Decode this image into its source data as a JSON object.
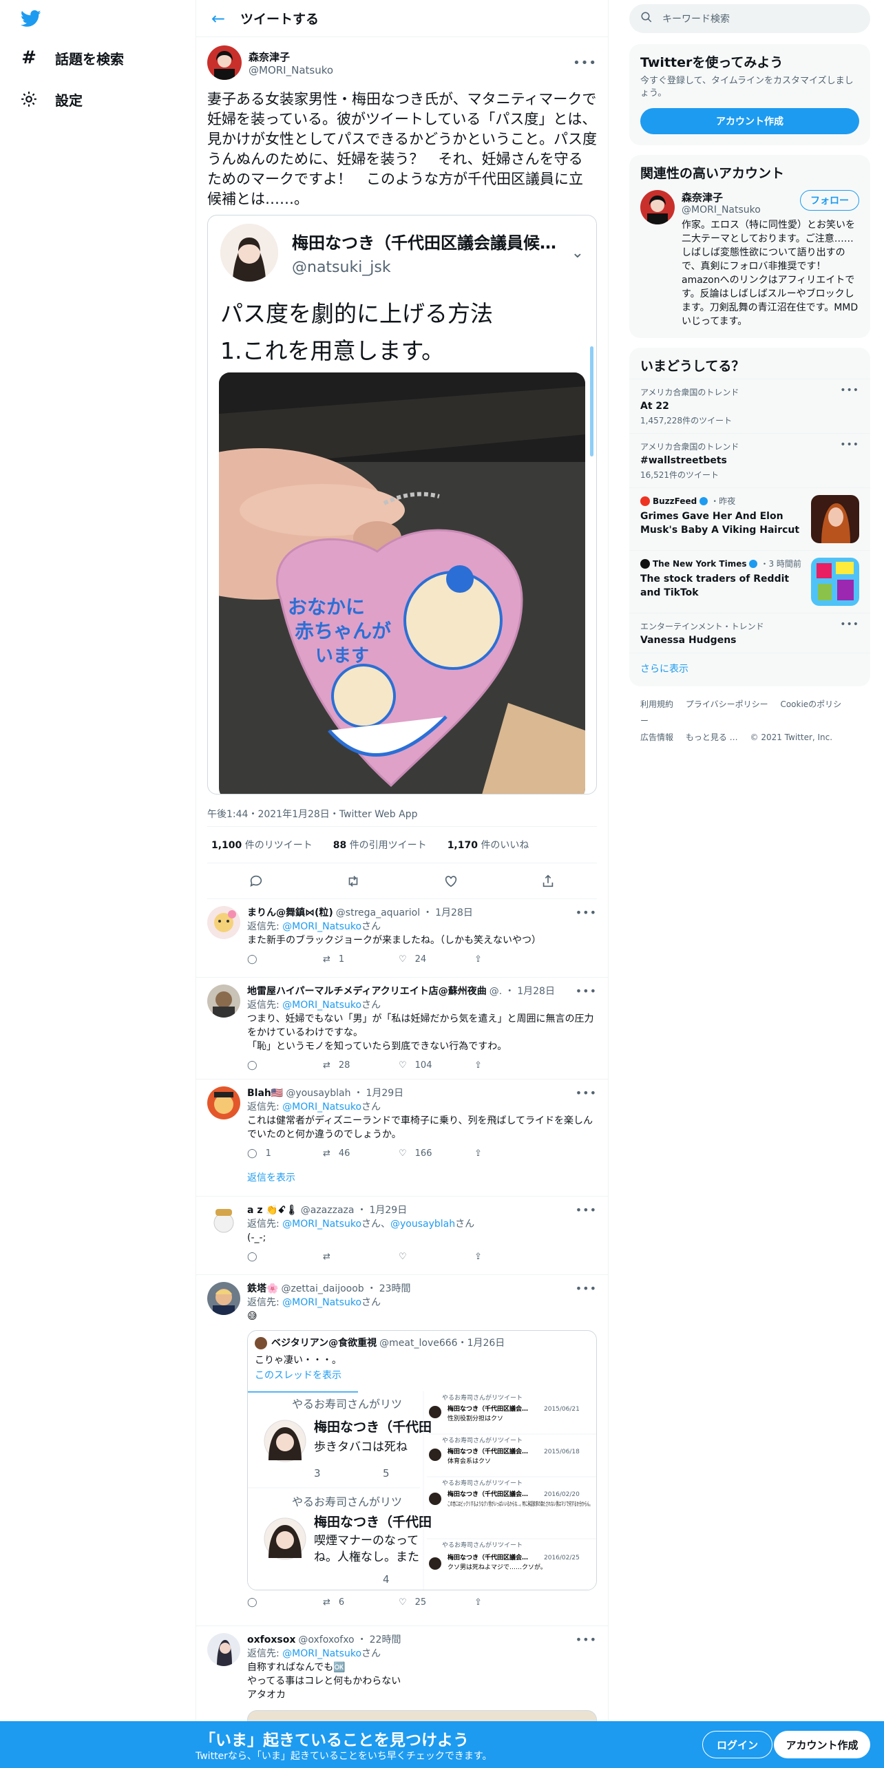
{
  "nav": {
    "explore_label": "話題を検索",
    "settings_label": "設定"
  },
  "header": {
    "title": "ツイートする"
  },
  "main_tweet": {
    "name": "森奈津子",
    "handle": "@MORI_Natsuko",
    "text": "妻子ある女装家男性・梅田なつき氏が、マタニティマークで妊婦を装っている。彼がツイートしている「パス度」とは、見かけが女性としてパスできるかどうかということ。パス度うんぬんのために、妊婦を装う？　それ、妊婦さんを守るためのマークですよ！　このような方が千代田区議員に立候補とは……。",
    "embed": {
      "name": "梅田なつき（千代田区議会議員候補）",
      "handle": "@natsuki_jsk",
      "text_line1": "パス度を劇的に上げる方法",
      "text_line2": "1.これを用意します。",
      "badge_text_1": "おなかに",
      "badge_text_2": "赤ちゃんが",
      "badge_text_3": "います"
    },
    "meta": "午後1:44・2021年1月28日・Twitter Web App",
    "retweets_num": "1,100",
    "retweets_label": "件のリツイート",
    "quotes_num": "88",
    "quotes_label": "件の引用ツイート",
    "likes_num": "1,170",
    "likes_label": "件のいいね"
  },
  "replies": [
    {
      "name": "まりん@舞鎮⋈(粒)",
      "handle": "@strega_aquariol",
      "date": "1月28日",
      "to_prefix": "返信先: ",
      "to_user": "@MORI_Natsuko",
      "to_suffix": "さん",
      "text": "また新手のブラックジョークが来ましたね。（しかも笑えないやつ）",
      "retweets": "1",
      "likes": "24"
    },
    {
      "name": "地雷屋ハイパーマルチメディアクリエイト店@蘇州夜曲",
      "handle": "@.",
      "date": "1月28日",
      "to_prefix": "返信先: ",
      "to_user": "@MORI_Natsuko",
      "to_suffix": "さん",
      "text1": "つまり、妊婦でもない「男」が「私は妊婦だから気を遣え」と周囲に無言の圧力をかけているわけですな。",
      "text2": "「恥」というモノを知っていたら到底できない行為ですわ。",
      "retweets": "28",
      "likes": "104"
    },
    {
      "name": "Blah🇺🇸",
      "handle": "@yousayblah",
      "date": "1月29日",
      "to_prefix": "返信先: ",
      "to_user": "@MORI_Natsuko",
      "to_suffix": "さん",
      "text": "これは健常者がディズニーランドで車椅子に乗り、列を飛ばしてライドを楽しんでいたのと何か違うのでしょうか。",
      "replies": "1",
      "retweets": "46",
      "likes": "166",
      "show_replies": "返信を表示"
    },
    {
      "name": "a z 👏ꗃ🌡",
      "handle": "@azazzaza",
      "date": "1月29日",
      "to_prefix": "返信先: ",
      "to_user": "@MORI_Natsuko",
      "to_mid": "さん、",
      "to_user2": "@yousayblah",
      "to_suffix": "さん",
      "text": "(‐_‐;"
    },
    {
      "name": "鉄塔🌸",
      "handle": "@zettai_daijooob",
      "date": "23時間",
      "to_prefix": "返信先: ",
      "to_user": "@MORI_Natsuko",
      "to_suffix": "さん",
      "text": "😅",
      "quote": {
        "name": "ベジタリアン@食欲重視",
        "handle": "@meat_love666",
        "date": "1月26日",
        "text": "こりゃ凄い・・・。",
        "thread_link": "このスレッドを表示",
        "rt_label": "やるお寿司さんがリツ",
        "qname": "梅田なつき（千代田",
        "line_a": "歩きタバコは死ね",
        "line_b1": "喫煙マナーのなって",
        "line_b2": "ね。人権なし。また",
        "a_replies": "3",
        "a_rts": "5",
        "b_rts": "4",
        "mini": [
          {
            "rt": "やるお寿司さんがリツイート",
            "name": "梅田なつき（千代田区議会…",
            "date": "2015/06/21",
            "text": "性別役割分担はクソ"
          },
          {
            "rt": "やるお寿司さんがリツイート",
            "name": "梅田なつき（千代田区議会…",
            "date": "2015/06/18",
            "text": "体育会系はクソ"
          },
          {
            "rt": "やるお寿司さんがリツイート",
            "name": "梅田なつき（千代田区議会…",
            "date": "2016/02/20",
            "text": "この世にはビックリするようなクソ男がいっぱいいるからな…。特に承認欲求の満たされない男はマジで何するか分からん。"
          },
          {
            "rt": "やるお寿司さんがリツイート",
            "name": "梅田なつき（千代田区議会…",
            "date": "2016/02/25",
            "text": "クソ男は死ねよマジで……クソが。"
          }
        ]
      },
      "retweets": "6",
      "likes": "25"
    },
    {
      "name": "oxfoxsox",
      "handle": "@oxfoxofxo",
      "date": "22時間",
      "to_prefix": "返信先: ",
      "to_user": "@MORI_Natsuko",
      "to_suffix": "さん",
      "text1": "自称すればなんでも🆗",
      "text2": "やってる事はコレと何もかわらない",
      "text3": "アタオカ"
    }
  ],
  "right": {
    "search_placeholder": "キーワード検索",
    "join_title": "Twitterを使ってみよう",
    "join_sub": "今すぐ登録して、タイムラインをカスタマイズしましょう。",
    "join_button": "アカウント作成",
    "related_title": "関連性の高いアカウント",
    "related_name": "森奈津子",
    "related_handle": "@MORI_Natsuko",
    "follow_button": "フォロー",
    "related_bio": "作家。エロス（特に同性愛）とお笑いを二大テーマとしております。ご注意……しばしば変態性欲について語り出すので、真剣にフォロバ非推奨です！　amazonへのリンクはアフィリエイトです。反論はしばしばスルーやブロックします。刀剣乱舞の青江沼在住です。MMDいじってます。",
    "trends_title": "いまどうしてる？",
    "trends": [
      {
        "ctx": "アメリカ合衆国のトレンド",
        "title": "At 22",
        "count": "1,457,228件のツイート"
      },
      {
        "ctx": "アメリカ合衆国のトレンド",
        "title": "#wallstreetbets",
        "count": "16,521件のツイート"
      }
    ],
    "news": [
      {
        "source": "BuzzFeed",
        "time": "・昨夜",
        "headline": "Grimes Gave Her And Elon Musk's Baby A Viking Haircut"
      },
      {
        "source": "The New York Times",
        "time": "・3 時間前",
        "headline": "The stock traders of Reddit and TikTok"
      }
    ],
    "trend3_ctx": "エンターテインメント・トレンド",
    "trend3_title": "Vanessa Hudgens",
    "show_more": "さらに表示",
    "footer_terms": "利用規約",
    "footer_privacy": "プライバシーポリシー",
    "footer_cookie": "Cookieのポリシー",
    "footer_ads": "広告情報",
    "footer_more": "もっと見る …",
    "footer_copy": "© 2021 Twitter, Inc."
  },
  "bottom": {
    "headline": "「いま」起きていることを見つけよう",
    "sub": "Twitterなら、「いま」起きていることをいち早くチェックできます。",
    "login": "ログイン",
    "signup": "アカウント作成"
  },
  "colors": {
    "accent": "#1d9bf0",
    "text": "#0f1419",
    "muted": "#536471"
  }
}
